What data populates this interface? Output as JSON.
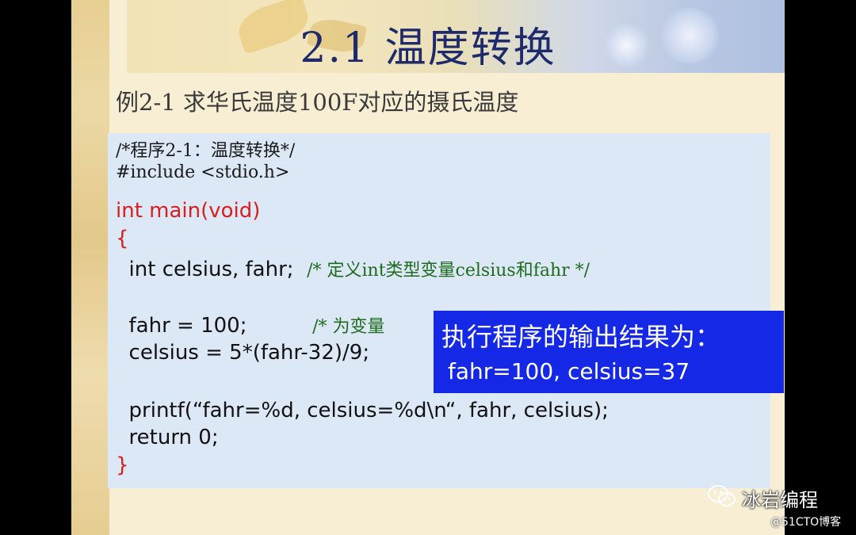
{
  "slide": {
    "title": "2.1  温度转换",
    "subtitle": "例2-1    求华氏温度100F对应的摄氏温度"
  },
  "code": {
    "line_comment_header": "/*程序2-1：温度转换*/",
    "line_include": "#include <stdio.h>",
    "line_main": "int main(void)",
    "line_open_brace": "{",
    "line_decl_code": "  int celsius, fahr;  ",
    "line_decl_comment": "/* 定义int类型变量celsius和fahr */",
    "line_assign_code": "  fahr = 100;          ",
    "line_assign_comment": "/* 为变量",
    "line_calc": "  celsius = 5*(fahr-32)/9;",
    "line_printf": "  printf(“fahr=%d, celsius=%d\\n“, fahr, celsius);",
    "line_return": "  return 0;",
    "line_close_brace": "}"
  },
  "output": {
    "heading": "执行程序的输出结果为：",
    "result": "fahr=100, celsius=37"
  },
  "overlay": {
    "brand": "冰岩编程",
    "watermark": "@51CTO博客"
  },
  "colors": {
    "title": "#1f2a6b",
    "keyword_red": "#d81e1e",
    "comment_green": "#1e6b1e",
    "code_panel": "#dce8f5",
    "output_box": "#1428e6",
    "slide_background": "#f7eed4"
  },
  "icons": {
    "brand_icon": "wechat-icon"
  }
}
